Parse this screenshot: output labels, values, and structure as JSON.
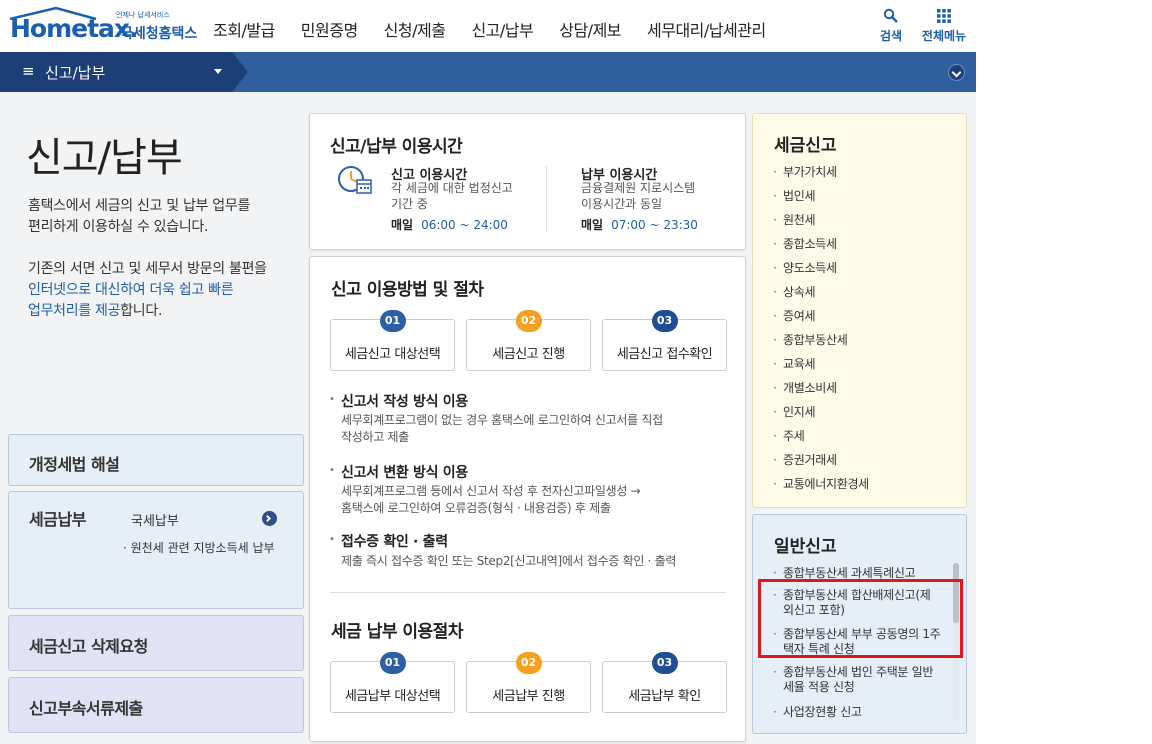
{
  "header": {
    "logo_main": "Hometax.",
    "logo_sub": "국세청홈택스",
    "logo_tag": "언제나 납세서비스",
    "gnb": [
      "조회/발급",
      "민원증명",
      "신청/제출",
      "신고/납부",
      "상담/제보",
      "세무대리/납세관리"
    ],
    "search_label": "검색",
    "menu_label": "전체메뉴"
  },
  "navbar": {
    "current": "신고/납부"
  },
  "left": {
    "title": "신고/납부",
    "desc1": [
      "홈택스에서 세금의 신고 및 납부 업무를",
      "편리하게 이용하실 수 있습니다."
    ],
    "desc2_line1": "기존의 서면 신고 및 세무서 방문의 불편을",
    "desc2_line2_blue": "인터넷으로 대신하여 더욱 쉽고 빠른",
    "desc2_line3_blue": "업무처리를 제공",
    "desc2_line3_tail": "합니다.",
    "boxes": {
      "tax_law": "개정세법 해설",
      "payment": "세금납부",
      "payment_item1": "국세납부",
      "payment_item2": "원천세 관련 지방소득세 납부",
      "delete_request": "세금신고 삭제요청",
      "attachments": "신고부속서류제출"
    }
  },
  "hours": {
    "title": "신고/납부 이용시간",
    "report_head": "신고 이용시간",
    "report_desc": [
      "각 세금에 대한 법정신고",
      "기간 중"
    ],
    "report_daily": "매일",
    "report_time": "06:00 ~ 24:00",
    "pay_head": "납부 이용시간",
    "pay_desc": [
      "금융결제원 지로시스템",
      "이용시간과 동일"
    ],
    "pay_daily": "매일",
    "pay_time": "07:00 ~ 23:30"
  },
  "procedure": {
    "title": "신고 이용방법 및 절차",
    "steps": [
      {
        "num": "01",
        "label": "세금신고 대상선택"
      },
      {
        "num": "02",
        "label": "세금신고 진행"
      },
      {
        "num": "03",
        "label": "세금신고 접수확인"
      }
    ],
    "methods": [
      {
        "head": "신고서 작성 방식 이용",
        "desc": [
          "세무회계프로그램이 없는 경우 홈택스에 로그인하여 신고서를 직접",
          "작성하고 제출"
        ]
      },
      {
        "head": "신고서 변환 방식 이용",
        "desc": [
          "세무회계프로그램 등에서 신고서 작성 후 전자신고파일생성 →",
          "홈택스에 로그인하여 오류검증(형식 · 내용검증) 후 제출"
        ]
      },
      {
        "head": "접수증 확인 · 출력",
        "desc": [
          "제출 즉시 접수증 확인 또는 Step2[신고내역]에서 접수증 확인 · 출력"
        ]
      }
    ],
    "pay_title": "세금 납부 이용절차",
    "pay_steps": [
      {
        "num": "01",
        "label": "세금납부 대상선택"
      },
      {
        "num": "02",
        "label": "세금납부 진행"
      },
      {
        "num": "03",
        "label": "세금납부 확인"
      }
    ]
  },
  "tax_report": {
    "title": "세금신고",
    "items": [
      "부가가치세",
      "법인세",
      "원천세",
      "종합소득세",
      "양도소득세",
      "상속세",
      "증여세",
      "종합부동산세",
      "교육세",
      "개별소비세",
      "인지세",
      "주세",
      "증권거래세",
      "교통에너지환경세"
    ]
  },
  "general_report": {
    "title": "일반신고",
    "items": [
      [
        "종합부동산세 과세특례신고"
      ],
      [
        "종합부동산세 합산배제신고(제",
        "외신고 포함)"
      ],
      [
        "종합부동산세 부부 공동명의 1주",
        "택자 특례 신청"
      ],
      [
        "종합부동산세 법인 주택분 일반",
        "세율 적용 신청"
      ],
      [
        "사업장현황 신고"
      ]
    ]
  },
  "colors": {
    "brand": "#1b5fb0",
    "navbar": "#2e5e9d",
    "highlight": "#e2171e",
    "step_orange": "#f5a020"
  }
}
